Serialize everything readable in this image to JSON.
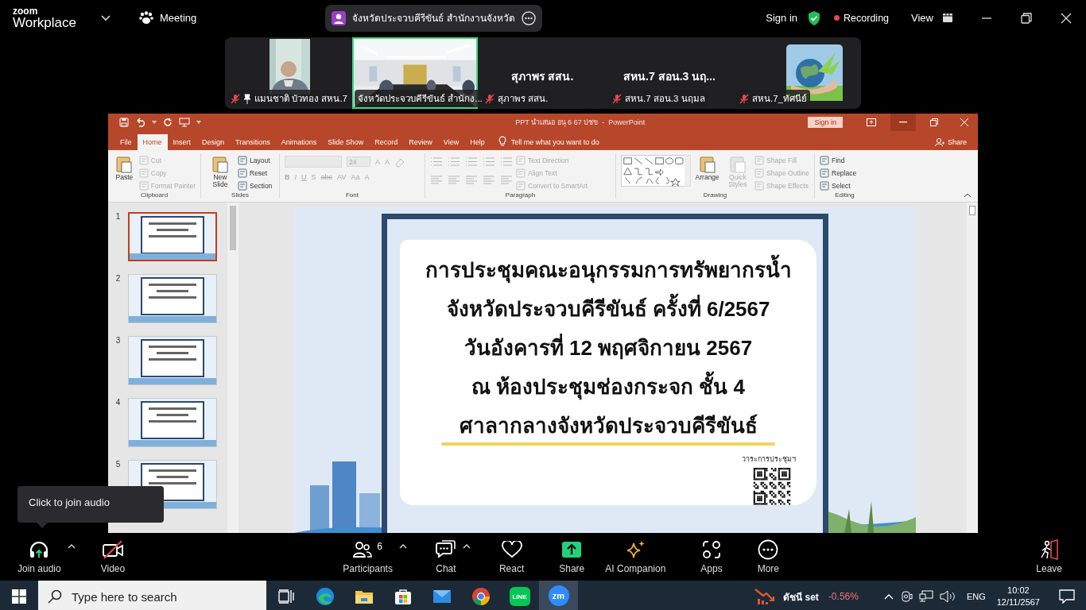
{
  "zoom": {
    "logo_top": "zoom",
    "logo": "Workplace",
    "meeting": "Meeting",
    "meeting_title": "จังหวัดประจวบคีรีขันธ์ สำนักงานจังหวัด",
    "sign_in": "Sign in",
    "recording": "Recording",
    "view": "View"
  },
  "gallery": [
    {
      "kind": "portrait",
      "name": "แมนชาติ บัวทอง สหน.7",
      "muted": true,
      "pinned": true,
      "selected": false
    },
    {
      "kind": "video",
      "name": "จังหวัดประจวบคีรีขันธ์ สำนักง...",
      "muted": false,
      "pinned": false,
      "selected": true
    },
    {
      "kind": "name",
      "display_name": "สุภาพร สสน.",
      "name": "สุภาพร สสน.",
      "muted": true,
      "pinned": false,
      "selected": false
    },
    {
      "kind": "name",
      "display_name": "สหน.7 สอน.3 นฤ...",
      "name": "สหน.7 สอน.3 นฤมล",
      "muted": true,
      "pinned": false,
      "selected": false
    },
    {
      "kind": "avatar",
      "name": "สหน.7_ทัศนีย์",
      "muted": true,
      "pinned": false,
      "selected": false
    }
  ],
  "powerpoint": {
    "title": "PPT นำเสนอ อนุ 6 67 ปชข  -  PowerPoint",
    "sign_in": "Sign in",
    "tabs": [
      {
        "label": "File",
        "selected": false
      },
      {
        "label": "Home",
        "selected": true
      },
      {
        "label": "Insert",
        "selected": false
      },
      {
        "label": "Design",
        "selected": false
      },
      {
        "label": "Transitions",
        "selected": false
      },
      {
        "label": "Animations",
        "selected": false
      },
      {
        "label": "Slide Show",
        "selected": false
      },
      {
        "label": "Record",
        "selected": false
      },
      {
        "label": "Review",
        "selected": false
      },
      {
        "label": "View",
        "selected": false
      },
      {
        "label": "Help",
        "selected": false
      }
    ],
    "tell_me": "Tell me what you want to do",
    "share": "Share",
    "ribbon": [
      {
        "label": "Clipboard",
        "items": [
          {
            "kind": "large",
            "label": "Paste",
            "disabled": false
          },
          {
            "kind": "stack",
            "items": [
              {
                "label": "Cut",
                "disabled": true
              },
              {
                "label": "Copy",
                "disabled": true
              },
              {
                "label": "Format Painter",
                "disabled": true
              }
            ]
          }
        ]
      },
      {
        "label": "Slides",
        "items": [
          {
            "kind": "large",
            "label": "New Slide",
            "disabled": false
          },
          {
            "kind": "stack",
            "items": [
              {
                "label": "Layout",
                "disabled": false
              },
              {
                "label": "Reset",
                "disabled": false
              },
              {
                "label": "Section",
                "disabled": false
              }
            ]
          }
        ]
      },
      {
        "label": "Font",
        "items": [
          {
            "kind": "font",
            "size": "24",
            "size_buttons": [
              "A",
              "A"
            ],
            "format_buttons": [
              "B",
              "I",
              "U",
              "S",
              "abc",
              "AV",
              "Aa",
              "A"
            ]
          }
        ]
      },
      {
        "label": "Paragraph",
        "items": [
          {
            "kind": "paragraph"
          },
          {
            "kind": "stack",
            "items": [
              {
                "label": "Text Direction",
                "disabled": true
              },
              {
                "label": "Align Text",
                "disabled": true
              },
              {
                "label": "Convert to SmartArt",
                "disabled": true
              }
            ]
          }
        ]
      },
      {
        "label": "Drawing",
        "items": [
          {
            "kind": "gallery"
          },
          {
            "kind": "large",
            "label": "Arrange",
            "disabled": false
          },
          {
            "kind": "large",
            "label": "Quick Styles",
            "disabled": true
          },
          {
            "kind": "stack",
            "items": [
              {
                "label": "Shape Fill",
                "disabled": true
              },
              {
                "label": "Shape Outline",
                "disabled": true
              },
              {
                "label": "Shape Effects",
                "disabled": true
              }
            ]
          }
        ]
      },
      {
        "label": "Editing",
        "items": [
          {
            "kind": "stack",
            "items": [
              {
                "label": "Find",
                "disabled": false
              },
              {
                "label": "Replace",
                "disabled": false
              },
              {
                "label": "Select",
                "disabled": false
              }
            ]
          }
        ]
      }
    ],
    "thumbnails": [
      {
        "number": "1",
        "selected": true
      },
      {
        "number": "2",
        "selected": false
      },
      {
        "number": "3",
        "selected": false
      },
      {
        "number": "4",
        "selected": false
      },
      {
        "number": "5",
        "selected": false
      }
    ],
    "slide": {
      "lines": [
        "การประชุมคณะอนุกรรมการทรัพยากรน้ำ",
        "จังหวัดประจวบคีรีขันธ์ ครั้งที่ 6/2567",
        "วันอังคารที่ 12 พฤศจิกายน 2567",
        "ณ ห้องประชุมช่องกระจก ชั้น 4",
        "ศาลากลางจังหวัดประจวบคีรีขันธ์"
      ],
      "agenda": "วาระการประชุมฯ"
    }
  },
  "tooltip": "Click to join audio",
  "toolbar": [
    {
      "kind": "audio",
      "label": "Join audio",
      "caret": true
    },
    {
      "kind": "video",
      "label": "Video",
      "caret": false
    },
    {
      "kind": "participants",
      "label": "Participants",
      "count": "6",
      "caret": true
    },
    {
      "kind": "chat",
      "label": "Chat",
      "caret": true
    },
    {
      "kind": "react",
      "label": "React",
      "caret": false
    },
    {
      "kind": "share",
      "label": "Share",
      "caret": false
    },
    {
      "kind": "ai",
      "label": "AI Companion",
      "caret": false
    },
    {
      "kind": "apps",
      "label": "Apps",
      "caret": false
    },
    {
      "kind": "more",
      "label": "More",
      "caret": false
    },
    {
      "kind": "leave",
      "label": "Leave",
      "caret": false
    }
  ],
  "taskbar": {
    "search_placeholder": "Type here to search",
    "apps": [
      {
        "kind": "task_view",
        "active": false
      },
      {
        "kind": "edge",
        "active": false
      },
      {
        "kind": "folder",
        "active": false
      },
      {
        "kind": "store",
        "active": false
      },
      {
        "kind": "mail",
        "active": false
      },
      {
        "kind": "chrome",
        "active": false
      },
      {
        "kind": "line",
        "label": "LINE",
        "active": false
      },
      {
        "kind": "zoom",
        "label": "zm",
        "active": true
      }
    ],
    "stock_name": "ดัชนี set",
    "stock_change": "-0.56%",
    "language": "ENG",
    "time": "10:02",
    "date": "12/11/2567"
  }
}
